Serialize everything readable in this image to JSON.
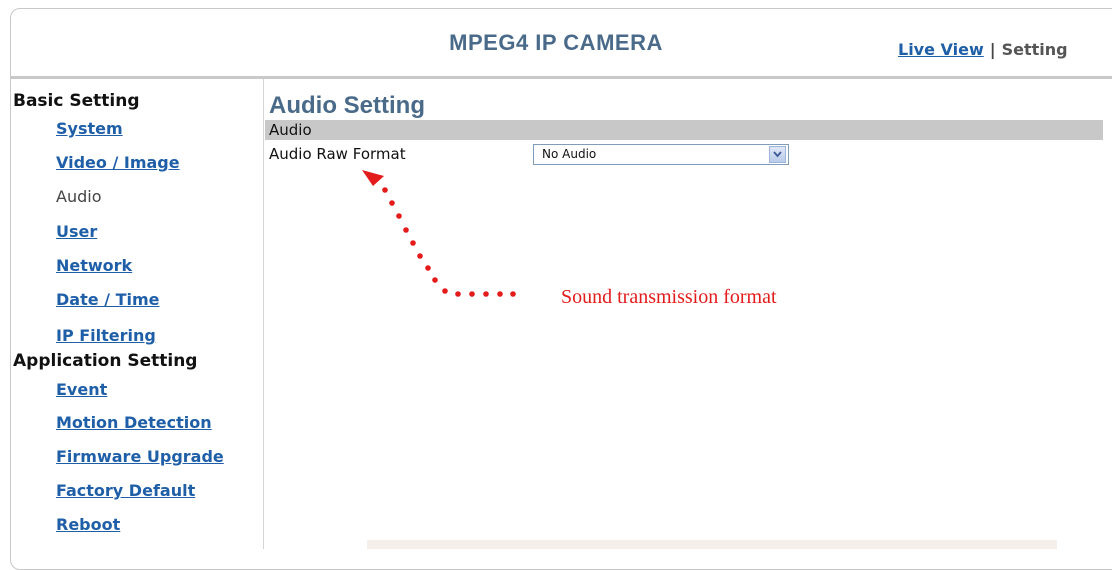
{
  "header": {
    "title": "MPEG4 IP CAMERA",
    "nav_live": "Live View",
    "nav_sep": "|",
    "nav_current": "Setting"
  },
  "sidebar": {
    "basic_group": "Basic Setting",
    "basic_items": [
      "System",
      "Video / Image",
      "Audio",
      "User",
      "Network",
      "Date / Time",
      "IP Filtering"
    ],
    "app_group": "Application Setting",
    "app_items": [
      "Event",
      "Motion Detection",
      "Firmware Upgrade",
      "Factory Default",
      "Reboot"
    ],
    "active_item": "Audio"
  },
  "main": {
    "title": "Audio Setting",
    "section": "Audio",
    "field_label": "Audio Raw Format",
    "select_value": "No Audio"
  },
  "annotation": {
    "text": "Sound transmission format",
    "color": "#e41b1b"
  },
  "colors": {
    "title_blue": "#4a6a8a",
    "link_blue": "#1f5fa8",
    "section_gray": "#c8c8c8"
  }
}
